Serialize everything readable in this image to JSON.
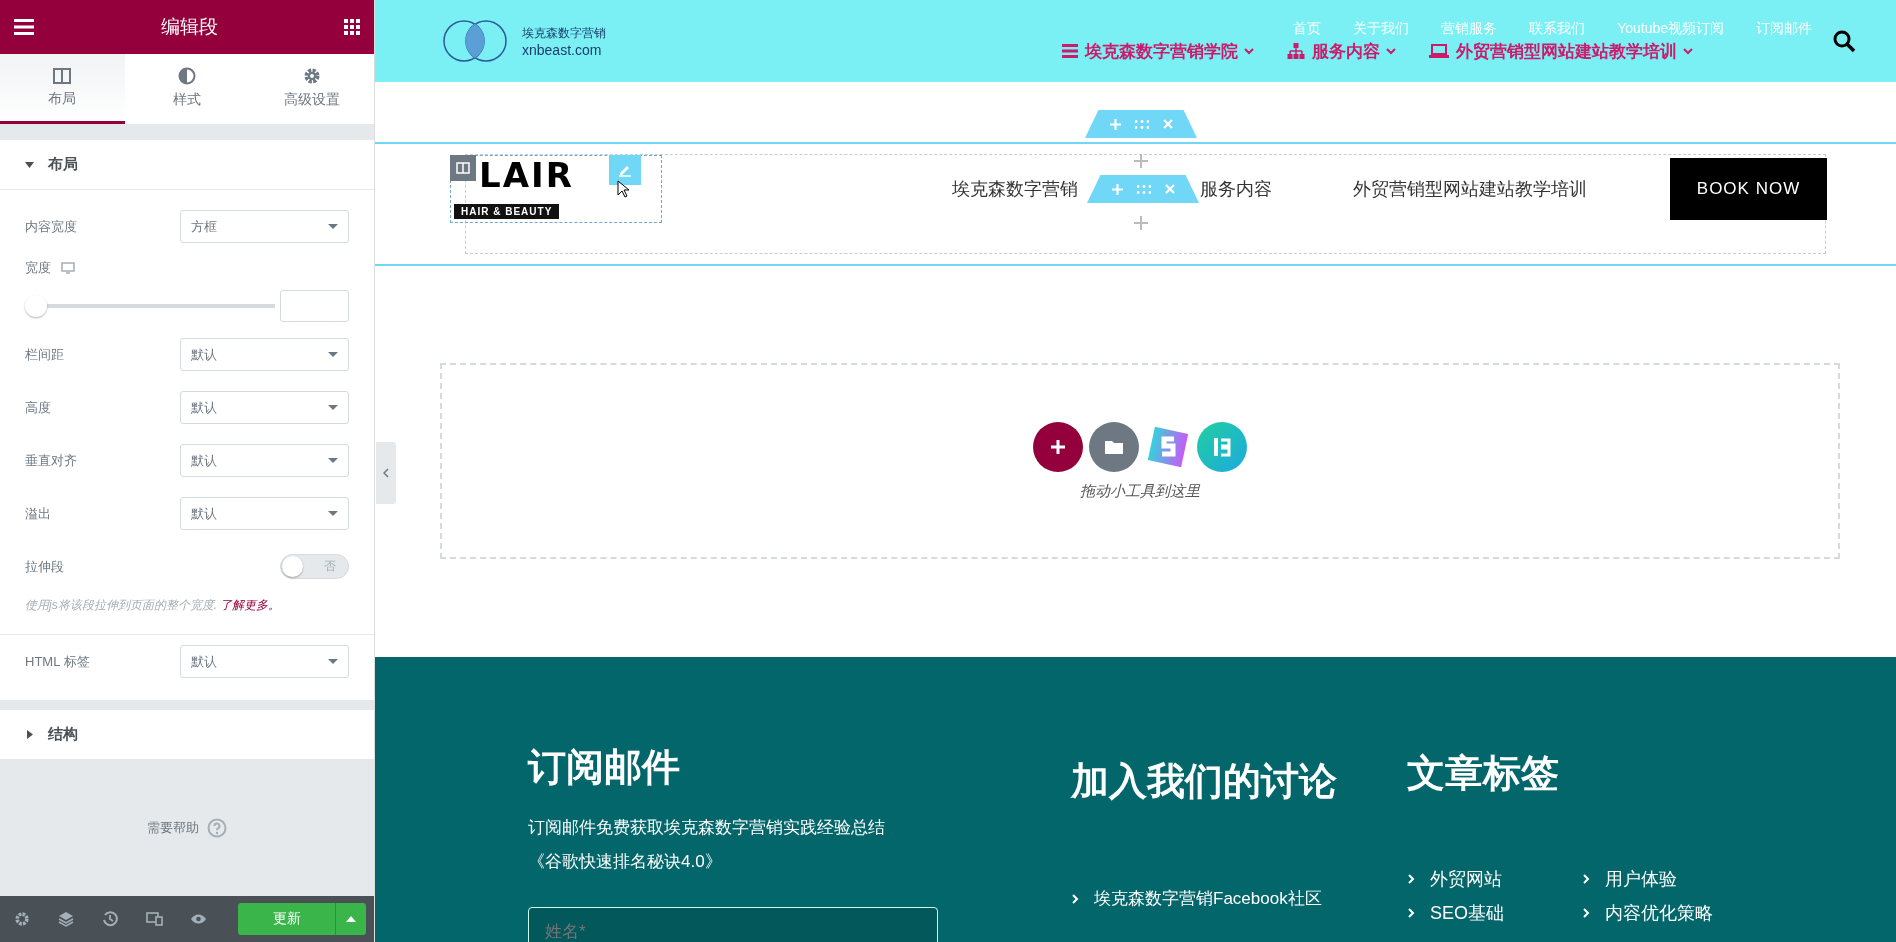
{
  "panel": {
    "title": "编辑段",
    "tabs": [
      {
        "label": "布局",
        "selected": true
      },
      {
        "label": "样式",
        "selected": false
      },
      {
        "label": "高级设置",
        "selected": false
      }
    ],
    "section": {
      "label": "布局",
      "expanded": true
    },
    "controls": [
      {
        "kind": "select",
        "label": "内容宽度",
        "value": "方框"
      },
      {
        "kind": "slider",
        "label": "宽度",
        "level": 0
      },
      {
        "kind": "select",
        "label": "栏间距",
        "value": "默认"
      },
      {
        "kind": "select",
        "label": "高度",
        "value": "默认"
      },
      {
        "kind": "select",
        "label": "垂直对齐",
        "value": "默认"
      },
      {
        "kind": "select",
        "label": "溢出",
        "value": "默认"
      },
      {
        "kind": "toggle",
        "label": "拉伸段",
        "on": false,
        "state_text": "否"
      },
      {
        "kind": "note",
        "text": "使用js将该段拉伸到页面的整个宽度. ",
        "link": "了解更多。"
      }
    ],
    "extra_controls": [
      {
        "kind": "select",
        "label": "HTML 标签",
        "value": "默认"
      }
    ],
    "collapsed_section": {
      "label": "结构",
      "expanded": false
    },
    "help": "需要帮助",
    "update_button": "更新"
  },
  "site": {
    "logo_name": "埃克森数字营销",
    "logo_domain": "xnbeast.com",
    "menu_top": [
      "首页",
      "关于我们",
      "营销服务",
      "联系我们",
      "Youtube视频订阅",
      "订阅邮件"
    ],
    "menu_main": [
      "埃克森数字营销学院",
      "服务内容",
      "外贸营销型网站建站教学培训"
    ]
  },
  "editor": {
    "logo_big": "LAIR",
    "logo_small": "HAIR & BEAUTY",
    "nav": [
      "埃克森数字营销",
      "服务内容",
      "外贸营销型网站建站教学培训"
    ],
    "book_button": "BOOK NOW",
    "drop_hint": "拖动小工具到这里"
  },
  "footer": {
    "subscribe": {
      "title": "订阅邮件",
      "text": "订阅邮件免费获取埃克森数字营销实践经验总结",
      "book": "《谷歌快速排名秘诀4.0》",
      "placeholder": "姓名*"
    },
    "discuss": {
      "title": "加入我们的讨论",
      "links": [
        "埃克森数字营销Facebook社区"
      ]
    },
    "tags": {
      "title": "文章标签",
      "items": [
        "外贸网站",
        "用户体验",
        "SEO基础",
        "内容优化策略"
      ]
    }
  }
}
